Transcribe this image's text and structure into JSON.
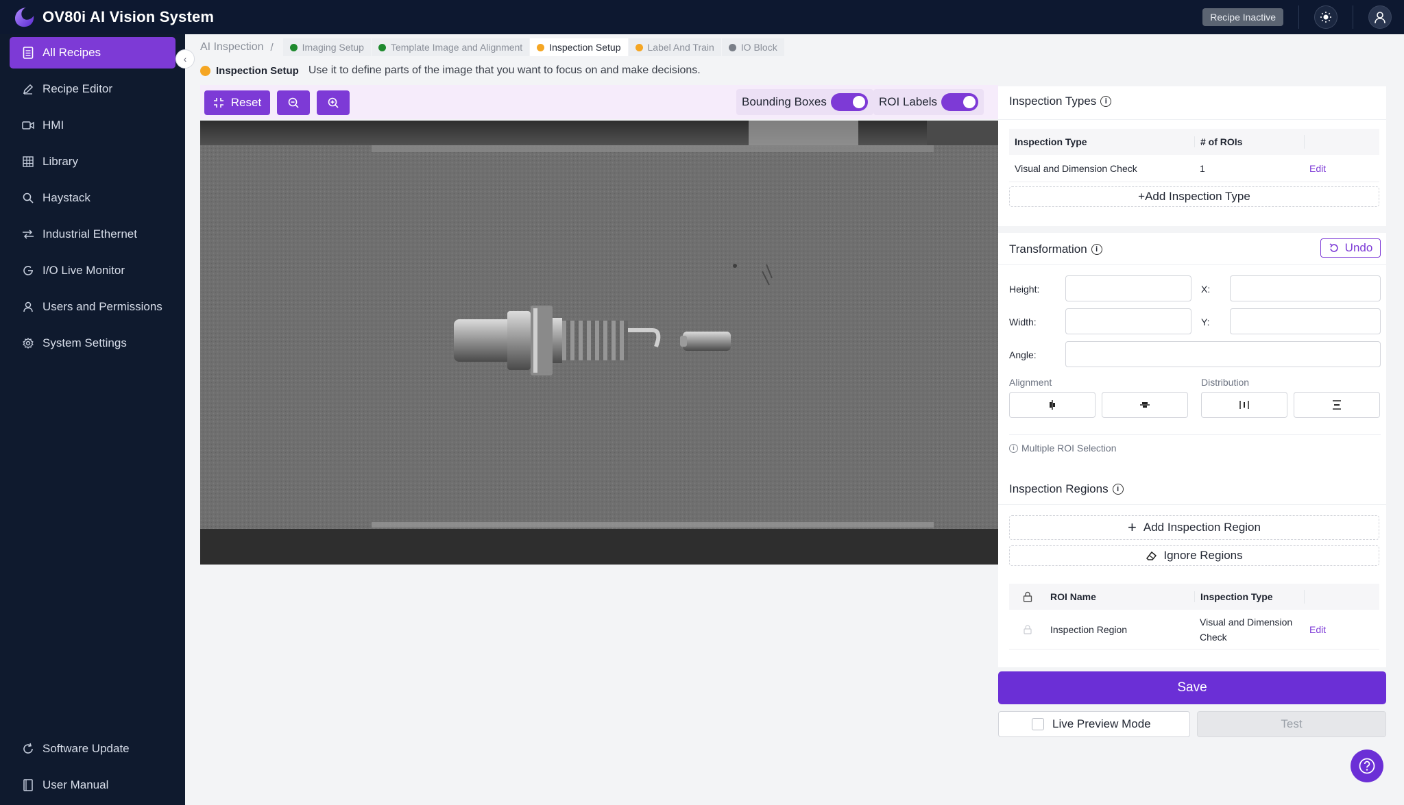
{
  "app": {
    "title": "OV80i AI Vision System",
    "status_badge": "Recipe Inactive"
  },
  "sidebar": {
    "items": [
      {
        "label": "All Recipes",
        "icon": "recipes-icon",
        "active": true
      },
      {
        "label": "Recipe Editor",
        "icon": "pencil-icon"
      },
      {
        "label": "HMI",
        "icon": "video-icon"
      },
      {
        "label": "Library",
        "icon": "grid-icon"
      },
      {
        "label": "Haystack",
        "icon": "search-icon"
      },
      {
        "label": "Industrial Ethernet",
        "icon": "network-icon"
      },
      {
        "label": "I/O Live Monitor",
        "icon": "monitor-icon"
      },
      {
        "label": "Users and Permissions",
        "icon": "user-icon"
      },
      {
        "label": "System Settings",
        "icon": "gear-icon"
      }
    ],
    "bottom": [
      {
        "label": "Software Update",
        "icon": "refresh-icon"
      },
      {
        "label": "User Manual",
        "icon": "book-icon"
      }
    ]
  },
  "breadcrumb": {
    "root": "AI Inspection",
    "separator": "/",
    "steps": [
      {
        "label": "Imaging Setup",
        "color": "#1f8a2e"
      },
      {
        "label": "Template Image and Alignment",
        "color": "#1f8a2e"
      },
      {
        "label": "Inspection Setup",
        "color": "#f5a623",
        "active": true
      },
      {
        "label": "Label And Train",
        "color": "#f5a623"
      },
      {
        "label": "IO Block",
        "color": "#7a7f88"
      }
    ]
  },
  "step_info": {
    "name": "Inspection Setup",
    "description": "Use it to define parts of the image that you want to focus on and make decisions."
  },
  "toolbar": {
    "reset": "Reset",
    "bounding_boxes": "Bounding Boxes",
    "bounding_boxes_on": true,
    "roi_labels": "ROI Labels",
    "roi_labels_on": true
  },
  "inspection_types": {
    "title": "Inspection Types",
    "columns": [
      "Inspection Type",
      "# of ROIs"
    ],
    "rows": [
      {
        "type": "Visual and Dimension Check",
        "rois": "1",
        "action": "Edit"
      }
    ],
    "add_button": "+Add Inspection Type"
  },
  "transformation": {
    "title": "Transformation",
    "undo": "Undo",
    "height_label": "Height:",
    "width_label": "Width:",
    "angle_label": "Angle:",
    "x_label": "X:",
    "y_label": "Y:",
    "alignment_label": "Alignment",
    "distribution_label": "Distribution",
    "multiple_roi": "Multiple ROI Selection"
  },
  "inspection_regions": {
    "title": "Inspection Regions",
    "add_button": "Add Inspection Region",
    "ignore_button": "Ignore Regions",
    "columns": [
      "ROI Name",
      "Inspection Type"
    ],
    "rows": [
      {
        "name": "Inspection Region",
        "type_line1": "Visual and Dimension",
        "type_line2": "Check",
        "action": "Edit"
      }
    ]
  },
  "actions": {
    "save": "Save",
    "live_preview": "Live Preview Mode",
    "test": "Test"
  },
  "colors": {
    "accent": "#7d3ad6",
    "sidebar_bg": "#0f1a2e",
    "save": "#6b2fd6"
  }
}
